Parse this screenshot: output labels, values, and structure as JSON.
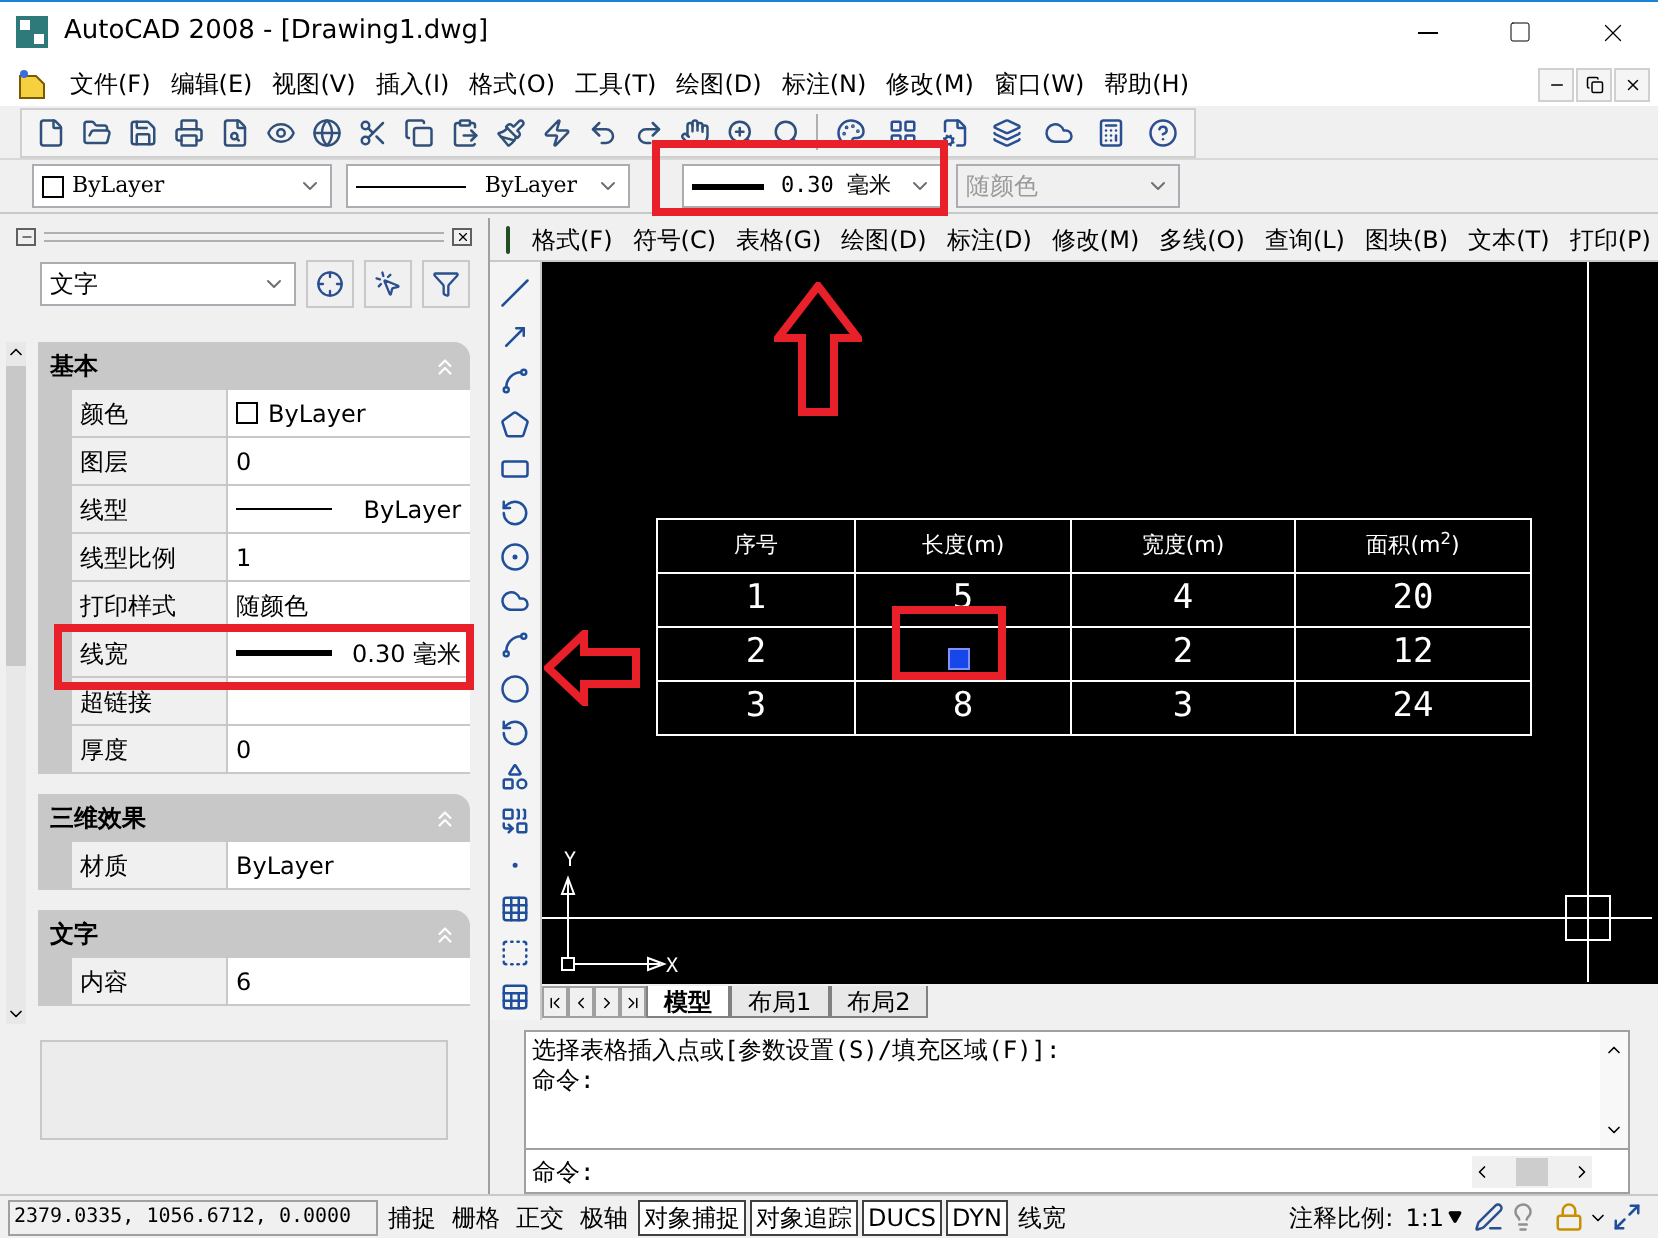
{
  "window": {
    "title": "AutoCAD 2008 - [Drawing1.dwg]"
  },
  "menu": [
    "文件(F)",
    "编辑(E)",
    "视图(V)",
    "插入(I)",
    "格式(O)",
    "工具(T)",
    "绘图(D)",
    "标注(N)",
    "修改(M)",
    "窗口(W)",
    "帮助(H)"
  ],
  "properties_toolbar": {
    "color_setting": "ByLayer",
    "linetype": "ByLayer",
    "lineweight": "0.30 毫米",
    "plot_style": {
      "value": "随颜色",
      "disabled": true
    }
  },
  "palette": {
    "selector": "文字",
    "sections": [
      {
        "title": "基本",
        "expanded": true,
        "rows": [
          {
            "kind": "color",
            "label": "颜色",
            "value": "ByLayer"
          },
          {
            "kind": "plain",
            "label": "图层",
            "value": "0"
          },
          {
            "kind": "linetype",
            "label": "线型",
            "value": "ByLayer"
          },
          {
            "kind": "plain",
            "label": "线型比例",
            "value": "1"
          },
          {
            "kind": "plain",
            "label": "打印样式",
            "value": "随颜色"
          },
          {
            "kind": "lineweight",
            "label": "线宽",
            "value": "0.30 毫米"
          },
          {
            "kind": "plain",
            "label": "超链接"
          },
          {
            "kind": "plain",
            "label": "厚度",
            "value": "0"
          }
        ]
      },
      {
        "title": "三维效果",
        "expanded": true,
        "rows": [
          {
            "kind": "plain",
            "label": "材质",
            "value": "ByLayer"
          }
        ]
      },
      {
        "title": "文字",
        "expanded": true,
        "rows": [
          {
            "kind": "plain",
            "label": "内容",
            "value": "6"
          }
        ]
      }
    ]
  },
  "express_menu": [
    "格式(F)",
    "符号(C)",
    "表格(G)",
    "绘图(D)",
    "标注(D)",
    "修改(M)",
    "多线(O)",
    "查询(L)",
    "图块(B)",
    "文本(T)",
    "打印(P)"
  ],
  "drawing": {
    "table": {
      "header": [
        "序号",
        "长度(m)",
        "宽度(m)",
        "面积(m$^{2}$)"
      ],
      "rows": [
        {
          "cells": [
            {
              "text": "1",
              "selected": false
            },
            {
              "text": "5",
              "selected": false
            },
            {
              "text": "4",
              "selected": false
            },
            {
              "text": "20",
              "selected": false
            }
          ]
        },
        {
          "cells": [
            {
              "text": "2",
              "selected": false
            },
            {
              "selected": true
            },
            {
              "text": "2",
              "selected": false
            },
            {
              "text": "12",
              "selected": false
            }
          ]
        },
        {
          "cells": [
            {
              "text": "3",
              "selected": false
            },
            {
              "text": "8",
              "selected": false
            },
            {
              "text": "3",
              "selected": false
            },
            {
              "text": "24",
              "selected": false
            }
          ]
        }
      ]
    },
    "ucs": {
      "y_label": "Y",
      "x_label": "X"
    }
  },
  "layout_tabs": [
    {
      "label": "模型",
      "selected": true
    },
    {
      "label": "布局1",
      "selected": false
    },
    {
      "label": "布局2",
      "selected": false
    }
  ],
  "command_history": [
    "选择表格插入点或[参数设置(S)/填充区域(F)]:",
    "命令:"
  ],
  "command_prompt": "命令:",
  "status_bar": {
    "coordinates": "2379.0335, 1056.6712, 0.0000",
    "toggles": [
      {
        "label": "捕捉",
        "on": false
      },
      {
        "label": "栅格",
        "on": false
      },
      {
        "label": "正交",
        "on": false
      },
      {
        "label": "极轴",
        "on": false
      },
      {
        "label": "对象捕捉",
        "on": true
      },
      {
        "label": "对象追踪",
        "on": true
      },
      {
        "label": "DUCS",
        "on": true
      },
      {
        "label": "DYN",
        "on": true
      },
      {
        "label": "线宽",
        "on": false
      }
    ],
    "annotation_scale_label": "注释比例:",
    "annotation_scale": "1:1"
  }
}
